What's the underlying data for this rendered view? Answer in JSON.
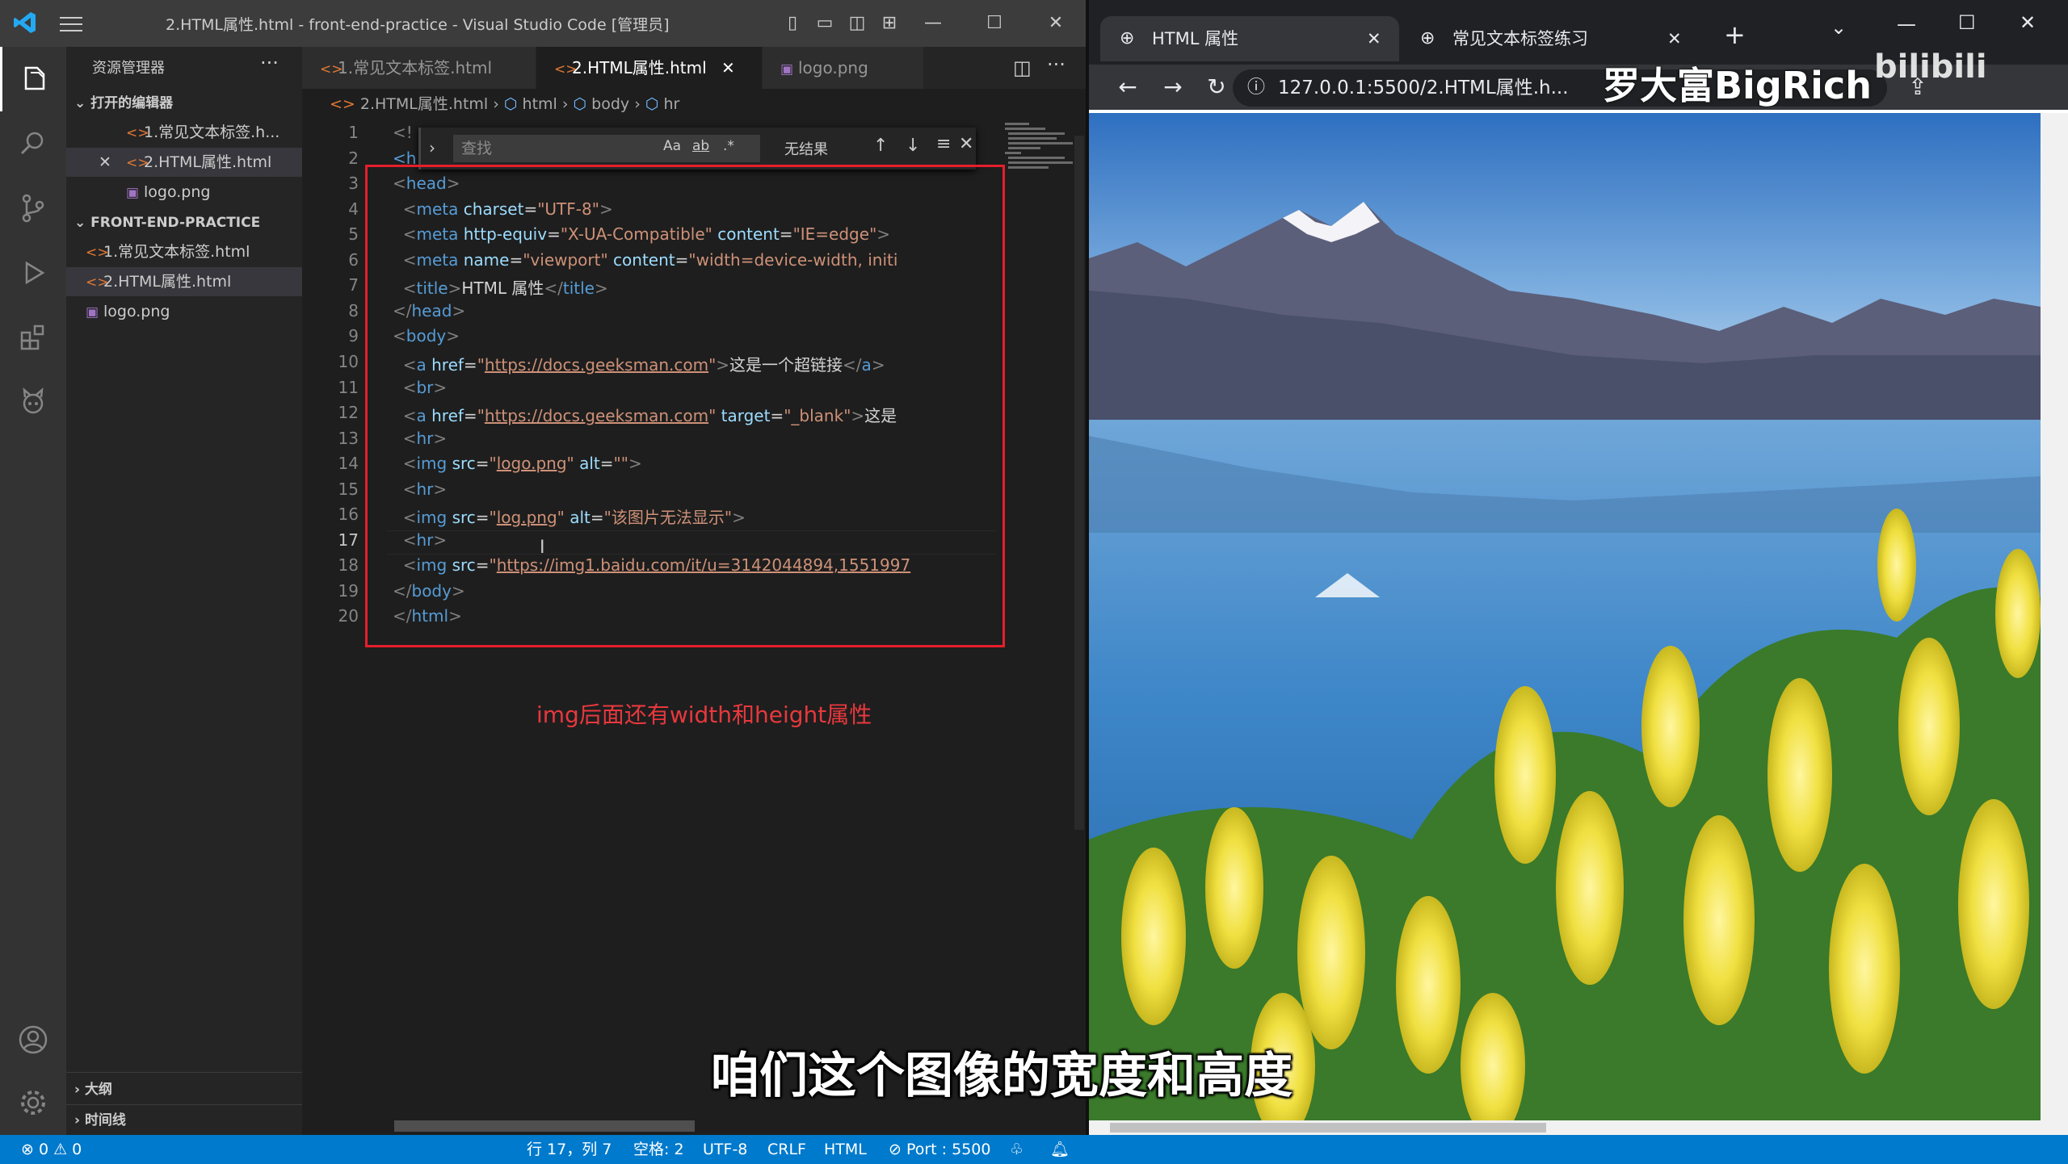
{
  "vscode": {
    "title": "2.HTML属性.html - front-end-practice - Visual Studio Code [管理员]",
    "explorer_title": "资源管理器",
    "open_editors_label": "打开的编辑器",
    "open_editors": [
      "1.常见文本标签.h...",
      "2.HTML属性.html",
      "logo.png"
    ],
    "project_label": "FRONT-END-PRACTICE",
    "project_files": [
      "1.常见文本标签.html",
      "2.HTML属性.html",
      "logo.png"
    ],
    "outline_label": "大纲",
    "timeline_label": "时间线",
    "tabs": [
      "1.常见文本标签.html",
      "2.HTML属性.html",
      "logo.png"
    ],
    "breadcrumb": [
      "2.HTML属性.html",
      "html",
      "body",
      "hr"
    ],
    "find": {
      "placeholder": "查找",
      "result": "无结果",
      "opt_case": "Aa",
      "opt_word": "ab",
      "opt_regex": ".*"
    },
    "note": "img后面还有width和height属性",
    "current_line": 17,
    "line_numbers": [
      1,
      2,
      3,
      4,
      5,
      6,
      7,
      8,
      9,
      10,
      11,
      12,
      13,
      14,
      15,
      16,
      17,
      18,
      19,
      20
    ],
    "code": {
      "l1": "<!",
      "l2": "<h",
      "meta_charset": "UTF-8",
      "meta_http_equiv": "X-UA-Compatible",
      "meta_content": "IE=edge",
      "meta_name": "viewport",
      "meta_viewport_content": "width=device-width, initi",
      "title_text": "HTML 属性",
      "href1": "https://docs.geeksman.com",
      "link1_text": "这是一个超链接",
      "href2": "https://docs.geeksman.com",
      "target": "_blank",
      "link2_text": "这是",
      "img1_src": "logo.png",
      "img1_alt": "",
      "img2_src": "log.png",
      "img2_alt": "该图片无法显示",
      "img3_src": "https://img1.baidu.com/it/u=3142044894,1551997"
    }
  },
  "statusbar": {
    "problems": "⊗ 0 ⚠ 0",
    "position": "行 17，列 7",
    "spaces": "空格: 2",
    "encoding": "UTF-8",
    "eol": "CRLF",
    "language": "HTML",
    "port": "⊘ Port : 5500"
  },
  "browser": {
    "tabs": [
      "HTML 属性",
      "常见文本标签练习"
    ],
    "url": "127.0.0.1:5500/2.HTML属性.h..."
  },
  "overlay": {
    "subtitle": "咱们这个图像的宽度和高度",
    "watermark": "罗大富BigRich",
    "watermark_logo": "bilibili"
  },
  "colors": {
    "editor_bg": "#1e1e1e",
    "statusbar": "#007acc",
    "redbox": "#e51f2b"
  }
}
